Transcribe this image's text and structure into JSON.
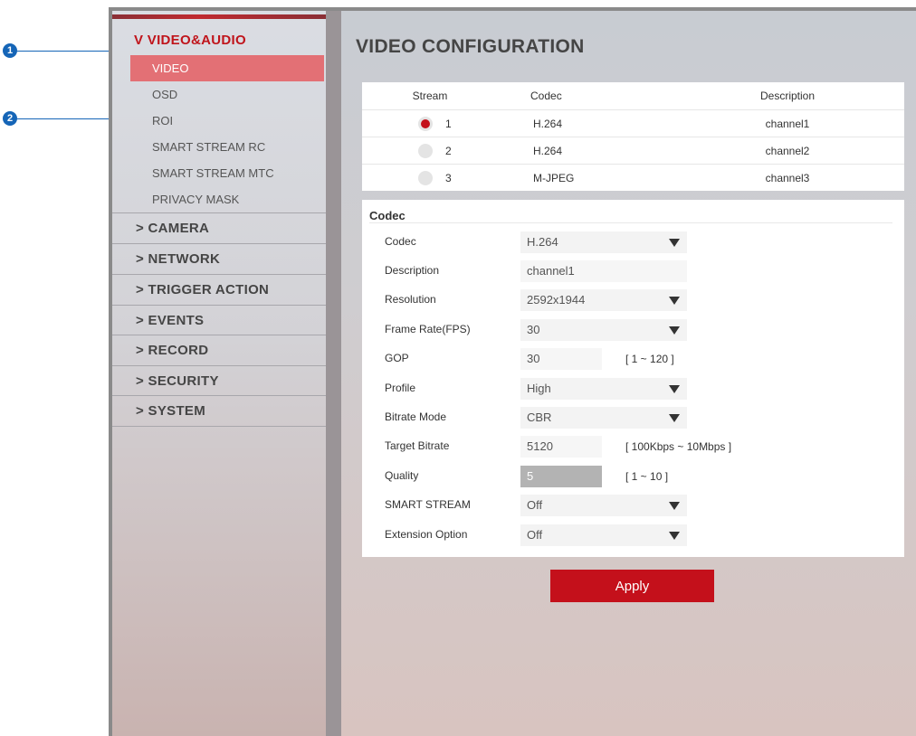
{
  "callouts": [
    {
      "number": "1"
    },
    {
      "number": "2"
    }
  ],
  "sidebar": {
    "section_title": "V VIDEO&AUDIO",
    "subitems": [
      {
        "label": "VIDEO",
        "active": true
      },
      {
        "label": "OSD",
        "active": false
      },
      {
        "label": "ROI",
        "active": false
      },
      {
        "label": "SMART STREAM RC",
        "active": false
      },
      {
        "label": "SMART STREAM MTC",
        "active": false
      },
      {
        "label": "PRIVACY MASK",
        "active": false
      }
    ],
    "categories": [
      {
        "label": "> CAMERA"
      },
      {
        "label": "> NETWORK"
      },
      {
        "label": "> TRIGGER ACTION"
      },
      {
        "label": "> EVENTS"
      },
      {
        "label": "> RECORD"
      },
      {
        "label": "> SECURITY"
      },
      {
        "label": "> SYSTEM"
      }
    ]
  },
  "main": {
    "title": "VIDEO CONFIGURATION",
    "stream_table": {
      "headers": {
        "stream": "Stream",
        "codec": "Codec",
        "description": "Description"
      },
      "rows": [
        {
          "num": "1",
          "codec": "H.264",
          "description": "channel1",
          "selected": true
        },
        {
          "num": "2",
          "codec": "H.264",
          "description": "channel2",
          "selected": false
        },
        {
          "num": "3",
          "codec": "M-JPEG",
          "description": "channel3",
          "selected": false
        }
      ]
    },
    "codec_panel": {
      "title": "Codec",
      "fields": [
        {
          "label": "Codec",
          "value": "H.264",
          "type": "select"
        },
        {
          "label": "Description",
          "value": "channel1",
          "type": "text"
        },
        {
          "label": "Resolution",
          "value": "2592x1944",
          "type": "select"
        },
        {
          "label": "Frame Rate(FPS)",
          "value": "30",
          "type": "select"
        },
        {
          "label": "GOP",
          "value": "30",
          "type": "text",
          "range": "[ 1 ~ 120 ]"
        },
        {
          "label": "Profile",
          "value": "High",
          "type": "select"
        },
        {
          "label": "Bitrate Mode",
          "value": "CBR",
          "type": "select"
        },
        {
          "label": "Target Bitrate",
          "value": "5120",
          "type": "text",
          "range": "[ 100Kbps ~ 10Mbps ]"
        },
        {
          "label": "Quality",
          "value": "5",
          "type": "disabled",
          "range": "[ 1 ~ 10 ]"
        },
        {
          "label": "SMART STREAM",
          "value": "Off",
          "type": "select"
        },
        {
          "label": "Extension Option",
          "value": "Off",
          "type": "select"
        }
      ]
    },
    "apply_label": "Apply"
  },
  "colors": {
    "accent_red": "#c4101b",
    "active_item": "#e37075",
    "callout_blue": "#1565b7"
  },
  "icons": {
    "caret": "caret-down-icon",
    "radio": "radio-icon"
  }
}
